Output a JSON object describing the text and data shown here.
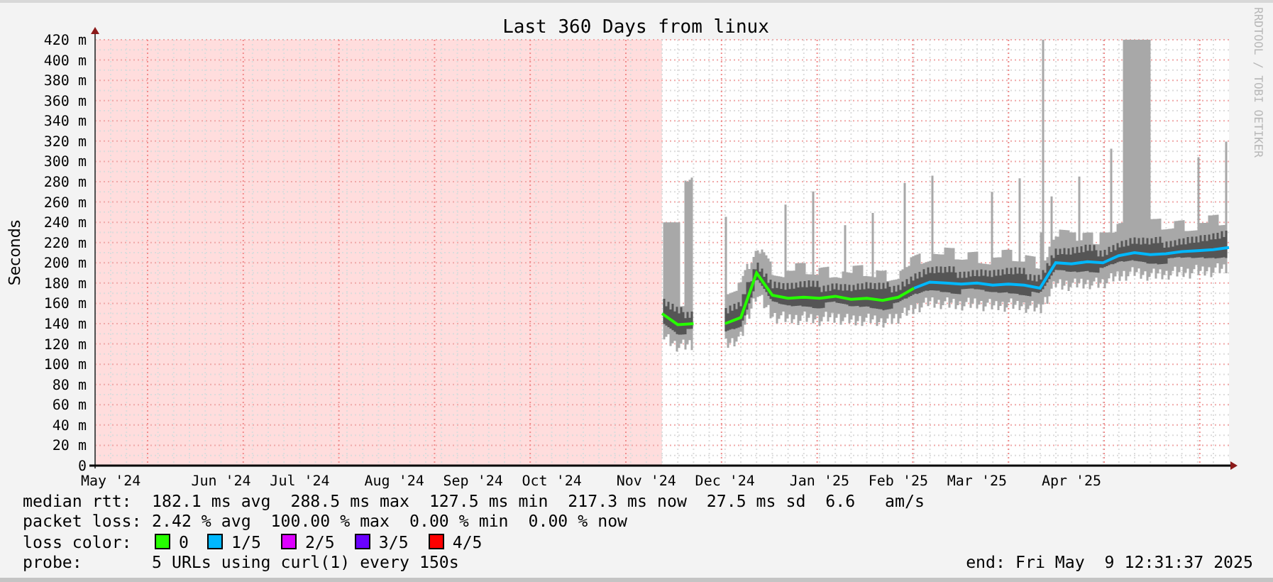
{
  "chart_title": "Last 360 Days from linux",
  "credit": "RRDTOOL / TOBI OETIKER",
  "chart_data": {
    "type": "line",
    "grid": true,
    "ylabel": "Seconds",
    "ylim": [
      0,
      420
    ],
    "categories": [
      null,
      "May '24",
      null,
      null,
      null,
      null,
      null,
      null,
      "Jun '24",
      null,
      null,
      null,
      null,
      "Jul '24",
      null,
      null,
      null,
      null,
      null,
      "Aug '24",
      null,
      null,
      null,
      null,
      "Sep '24",
      null,
      null,
      null,
      null,
      "Oct '24",
      null,
      null,
      null,
      null,
      null,
      "Nov '24",
      null,
      null,
      null,
      null,
      "Dec '24",
      null,
      null,
      null,
      null,
      null,
      "Jan '25",
      null,
      null,
      null,
      null,
      "Feb '25",
      null,
      null,
      null,
      null,
      "Mar '25",
      null,
      null,
      null,
      null,
      null,
      "Apr '25",
      null,
      null,
      null,
      null,
      null,
      null,
      null,
      null,
      null,
      null
    ],
    "series": [
      {
        "color": "#26ff00",
        "values": [
          null,
          null,
          null,
          null,
          null,
          null,
          null,
          null,
          null,
          null,
          null,
          null,
          null,
          null,
          null,
          null,
          null,
          null,
          null,
          null,
          null,
          null,
          null,
          null,
          null,
          null,
          null,
          null,
          null,
          null,
          null,
          null,
          null,
          null,
          null,
          null,
          150,
          139,
          140,
          null,
          140,
          146,
          190,
          168,
          165,
          166,
          165,
          167,
          164,
          165,
          163,
          166,
          175,
          null,
          null,
          null,
          null,
          null,
          null,
          null,
          null,
          null,
          null,
          null,
          null,
          null,
          null,
          null,
          null,
          null,
          null,
          null,
          null
        ]
      },
      {
        "color": "#00b8ff",
        "values": [
          null,
          null,
          null,
          null,
          null,
          null,
          null,
          null,
          null,
          null,
          null,
          null,
          null,
          null,
          null,
          null,
          null,
          null,
          null,
          null,
          null,
          null,
          null,
          null,
          null,
          null,
          null,
          null,
          null,
          null,
          null,
          null,
          null,
          null,
          null,
          null,
          null,
          null,
          null,
          null,
          null,
          null,
          null,
          null,
          null,
          null,
          null,
          null,
          null,
          null,
          null,
          null,
          175,
          181,
          180,
          179,
          180,
          178,
          179,
          178,
          175,
          200,
          199,
          201,
          200,
          207,
          210,
          208,
          209,
          211,
          212,
          213,
          215
        ]
      }
    ],
    "yticks": [
      {
        "value": 0,
        "label": "0"
      },
      {
        "value": 20,
        "label": "20 m"
      },
      {
        "value": 40,
        "label": "40 m"
      },
      {
        "value": 60,
        "label": "60 m"
      },
      {
        "value": 80,
        "label": "80 m"
      },
      {
        "value": 100,
        "label": "100 m"
      },
      {
        "value": 120,
        "label": "120 m"
      },
      {
        "value": 140,
        "label": "140 m"
      },
      {
        "value": 160,
        "label": "160 m"
      },
      {
        "value": 180,
        "label": "180 m"
      },
      {
        "value": 200,
        "label": "200 m"
      },
      {
        "value": 220,
        "label": "220 m"
      },
      {
        "value": 240,
        "label": "240 m"
      },
      {
        "value": 260,
        "label": "260 m"
      },
      {
        "value": 280,
        "label": "280 m"
      },
      {
        "value": 300,
        "label": "300 m"
      },
      {
        "value": 320,
        "label": "320 m"
      },
      {
        "value": 340,
        "label": "340 m"
      },
      {
        "value": 360,
        "label": "360 m"
      },
      {
        "value": 380,
        "label": "380 m"
      },
      {
        "value": 400,
        "label": "400 m"
      },
      {
        "value": 420,
        "label": "420 m"
      }
    ]
  },
  "legend": [
    {
      "kind": "text",
      "label": "median rtt:",
      "value": "182.1 ms avg  288.5 ms max  127.5 ms min  217.3 ms now  27.5 ms sd  6.6   am/s"
    },
    {
      "kind": "text",
      "label": "packet loss:",
      "value": "2.42 % avg  100.00 % max  0.00 % min  0.00 % now"
    },
    {
      "kind": "swatches",
      "label": "loss color:",
      "items": [
        {
          "label": "0",
          "color": "#26ff00"
        },
        {
          "label": "1/5",
          "color": "#00b8ff"
        },
        {
          "label": "2/5",
          "color": "#dd00ff"
        },
        {
          "label": "3/5",
          "color": "#6a00ff"
        },
        {
          "label": "4/5",
          "color": "#ff0000"
        }
      ]
    },
    {
      "kind": "text",
      "label": "probe:",
      "value": "5 URLs using curl(1) every 150s"
    }
  ],
  "end_time": "end: Fri May  9 12:31:37 2025"
}
